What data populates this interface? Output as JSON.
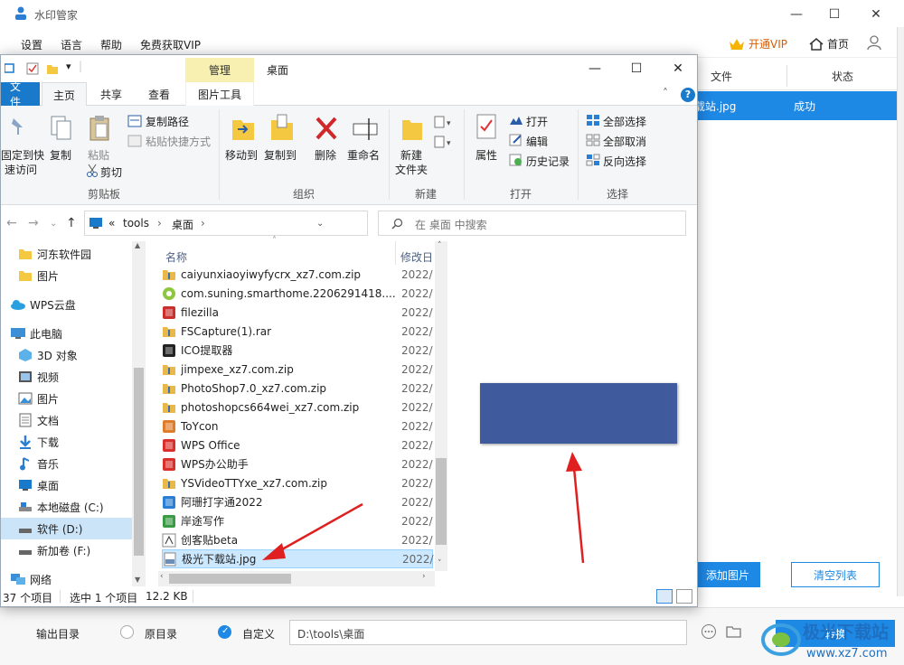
{
  "app": {
    "title": "水印管家",
    "menu": [
      "设置",
      "语言",
      "帮助",
      "免费获取VIP"
    ],
    "vip_label": "开通VIP",
    "home_label": "首页",
    "table_headers": {
      "file": "文件",
      "status": "状态"
    },
    "row": {
      "file": "载站.jpg",
      "status": "成功"
    },
    "add_button": "添加图片",
    "add_button_visible": "添加图片",
    "clear_button": "清空列表",
    "footer": {
      "output_label": "输出目录",
      "radio_original": "原目录",
      "radio_custom": "自定义",
      "path_value": "D:\\tools\\桌面",
      "convert_button": "转换"
    },
    "brand_text": "极光下载站",
    "brand_url": "www.xz7.com"
  },
  "explorer": {
    "title": "桌面",
    "context_tab": "管理",
    "ribbon_tabs": [
      "文件",
      "主页",
      "共享",
      "查看",
      "图片工具"
    ],
    "ribbon": {
      "clipboard": {
        "pin_l1": "固定到快",
        "pin_l2": "速访问",
        "copy": "复制",
        "paste": "粘贴",
        "copy_path": "复制路径",
        "paste_shortcut": "粘贴快捷方式",
        "cut": "剪切",
        "label": "剪贴板"
      },
      "organize": {
        "move_to": "移动到",
        "copy_to": "复制到",
        "delete": "删除",
        "rename": "重命名",
        "label": "组织"
      },
      "new": {
        "new_folder_l1": "新建",
        "new_folder_l2": "文件夹",
        "label": "新建"
      },
      "open": {
        "properties": "属性",
        "open": "打开",
        "edit": "编辑",
        "history": "历史记录",
        "label": "打开"
      },
      "select": {
        "select_all": "全部选择",
        "select_none": "全部取消",
        "invert": "反向选择",
        "label": "选择"
      }
    },
    "address": {
      "chevron": "«",
      "part1": "tools",
      "part2": "桌面"
    },
    "search_placeholder": "在 桌面 中搜索",
    "nav": [
      {
        "label": "河东软件园",
        "icon": "folder-icon"
      },
      {
        "label": "图片",
        "icon": "folder-icon"
      },
      {
        "label": "WPS云盘",
        "icon": "cloud-icon"
      },
      {
        "label": "此电脑",
        "icon": "pc-icon"
      },
      {
        "label": "3D 对象",
        "icon": "3d-icon"
      },
      {
        "label": "视频",
        "icon": "video-icon"
      },
      {
        "label": "图片",
        "icon": "pictures-icon"
      },
      {
        "label": "文档",
        "icon": "documents-icon"
      },
      {
        "label": "下载",
        "icon": "download-icon"
      },
      {
        "label": "音乐",
        "icon": "music-icon"
      },
      {
        "label": "桌面",
        "icon": "desktop-icon"
      },
      {
        "label": "本地磁盘 (C:)",
        "icon": "drive-c-icon"
      },
      {
        "label": "软件 (D:)",
        "icon": "drive-d-icon"
      },
      {
        "label": "新加卷 (F:)",
        "icon": "drive-f-icon"
      },
      {
        "label": "网络",
        "icon": "network-icon"
      }
    ],
    "columns": {
      "name": "名称",
      "date": "修改日"
    },
    "files": [
      {
        "name": "caiyunxiaoyiwyfycrx_xz7.com.zip",
        "date": "2022/",
        "icon": "zip-icon",
        "color": "#e8b84a"
      },
      {
        "name": "com.suning.smarthome.2206291418....",
        "date": "2022/",
        "icon": "app-icon",
        "color": "#8dc63f"
      },
      {
        "name": "filezilla",
        "date": "2022/",
        "icon": "filezilla-icon",
        "color": "#c9302c"
      },
      {
        "name": "FSCapture(1).rar",
        "date": "2022/",
        "icon": "rar-icon",
        "color": "#e8b84a"
      },
      {
        "name": "ICO提取器",
        "date": "2022/",
        "icon": "ico-icon",
        "color": "#222222"
      },
      {
        "name": "jimpexe_xz7.com.zip",
        "date": "2022/",
        "icon": "zip-icon",
        "color": "#e8b84a"
      },
      {
        "name": "PhotoShop7.0_xz7.com.zip",
        "date": "2022/",
        "icon": "zip-icon",
        "color": "#e8b84a"
      },
      {
        "name": "photoshopcs664wei_xz7.com.zip",
        "date": "2022/",
        "icon": "zip-icon",
        "color": "#e8b84a"
      },
      {
        "name": "ToYcon",
        "date": "2022/",
        "icon": "toycon-icon",
        "color": "#e07b2a"
      },
      {
        "name": "WPS Office",
        "date": "2022/",
        "icon": "wps-icon",
        "color": "#d9302c"
      },
      {
        "name": "WPS办公助手",
        "date": "2022/",
        "icon": "wps-icon",
        "color": "#d9302c"
      },
      {
        "name": "YSVideoTTYxe_xz7.com.zip",
        "date": "2022/",
        "icon": "zip-icon",
        "color": "#e8b84a"
      },
      {
        "name": "阿珊打字通2022",
        "date": "2022/",
        "icon": "typing-icon",
        "color": "#2a7fd4"
      },
      {
        "name": "岸途写作",
        "date": "2022/",
        "icon": "writing-icon",
        "color": "#3a9b46"
      },
      {
        "name": "创客贴beta",
        "date": "2022/",
        "icon": "chuangke-icon",
        "color": "#ffffff"
      },
      {
        "name": "极光下载站.jpg",
        "date": "2022/",
        "icon": "jpg-icon",
        "color": "#6c8fb8"
      }
    ],
    "status": {
      "count": "37 个项目",
      "selected": "选中 1 个项目",
      "size": "12.2 KB"
    }
  }
}
